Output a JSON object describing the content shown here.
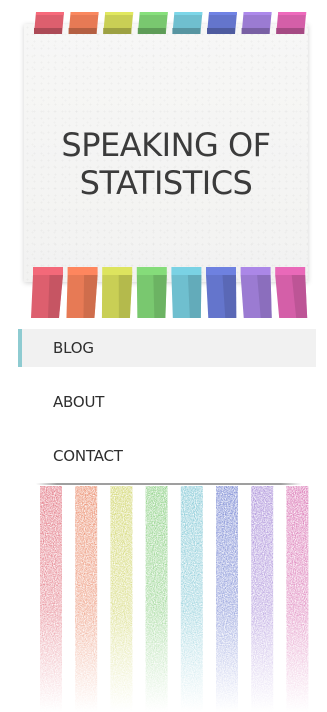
{
  "site": {
    "title_line1": "SPEAKING OF",
    "title_line2": "STATISTICS"
  },
  "nav": {
    "items": [
      {
        "label": "BLOG",
        "active": true
      },
      {
        "label": "ABOUT",
        "active": false
      },
      {
        "label": "CONTACT",
        "active": false
      }
    ]
  },
  "theme": {
    "accent": "#8ecbd1",
    "ribbon_colors": [
      "#dd5f6e",
      "#e77a55",
      "#c9cf55",
      "#79c86f",
      "#6fbfcf",
      "#6475cc",
      "#9b7bd2",
      "#d45fa8"
    ]
  }
}
